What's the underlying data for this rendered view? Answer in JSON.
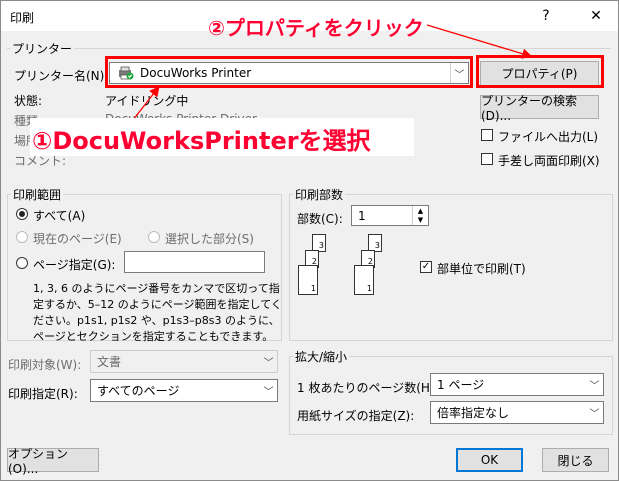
{
  "window": {
    "title": "印刷",
    "help_button": "?",
    "close_button": "✕"
  },
  "printer": {
    "group_label": "プリンター",
    "name_label": "プリンター名(N):",
    "selected": "DocuWorks Printer",
    "status_label": "状態:",
    "status_value": "アイドリング中",
    "type_label": "種類:",
    "type_value": "DocuWorks Printer Driver",
    "where_label": "場所:",
    "comment_label": "コメント:",
    "properties_button": "プロパティ(P)",
    "find_printer_button": "プリンターの検索(D)...",
    "print_to_file": "ファイルへ出力(L)",
    "manual_duplex": "手差し両面印刷(X)"
  },
  "range": {
    "group_label": "印刷範囲",
    "all": "すべて(A)",
    "current_page": "現在のページ(E)",
    "selection": "選択した部分(S)",
    "pages": "ページ指定(G):",
    "pages_value": "",
    "help_text_line1": "1, 3, 6 のようにページ番号をカンマで区切って指",
    "help_text_line2": "定するか、5–12 のようにページ範囲を指定してく",
    "help_text_line3": "ださい。p1s1, p1s2 や、p1s3–p8s3 のように、",
    "help_text_line4": "ページとセクションを指定することもできます。"
  },
  "copies": {
    "group_label": "印刷部数",
    "count_label": "部数(C):",
    "count_value": "1",
    "collate": "部単位で印刷(T)",
    "collate_checked": true
  },
  "print_what": {
    "label": "印刷対象(W):",
    "value": "文書"
  },
  "print_spec": {
    "label": "印刷指定(R):",
    "value": "すべてのページ"
  },
  "zoom": {
    "group_label": "拡大/縮小",
    "pages_per_sheet_label": "1 枚あたりのページ数(H):",
    "pages_per_sheet_value": "1 ページ",
    "scale_to_paper_label": "用紙サイズの指定(Z):",
    "scale_to_paper_value": "倍率指定なし"
  },
  "footer": {
    "options_button": "オプション(O)...",
    "ok_button": "OK",
    "close_button": "閉じる"
  },
  "annotations": {
    "step1": "①DocuWorksPrinterを選択",
    "step2": "②プロパティをクリック",
    "accent_color": "#ff0000"
  },
  "icons": {
    "printer": "printer-icon",
    "dropdown": "chevron-down-icon"
  }
}
